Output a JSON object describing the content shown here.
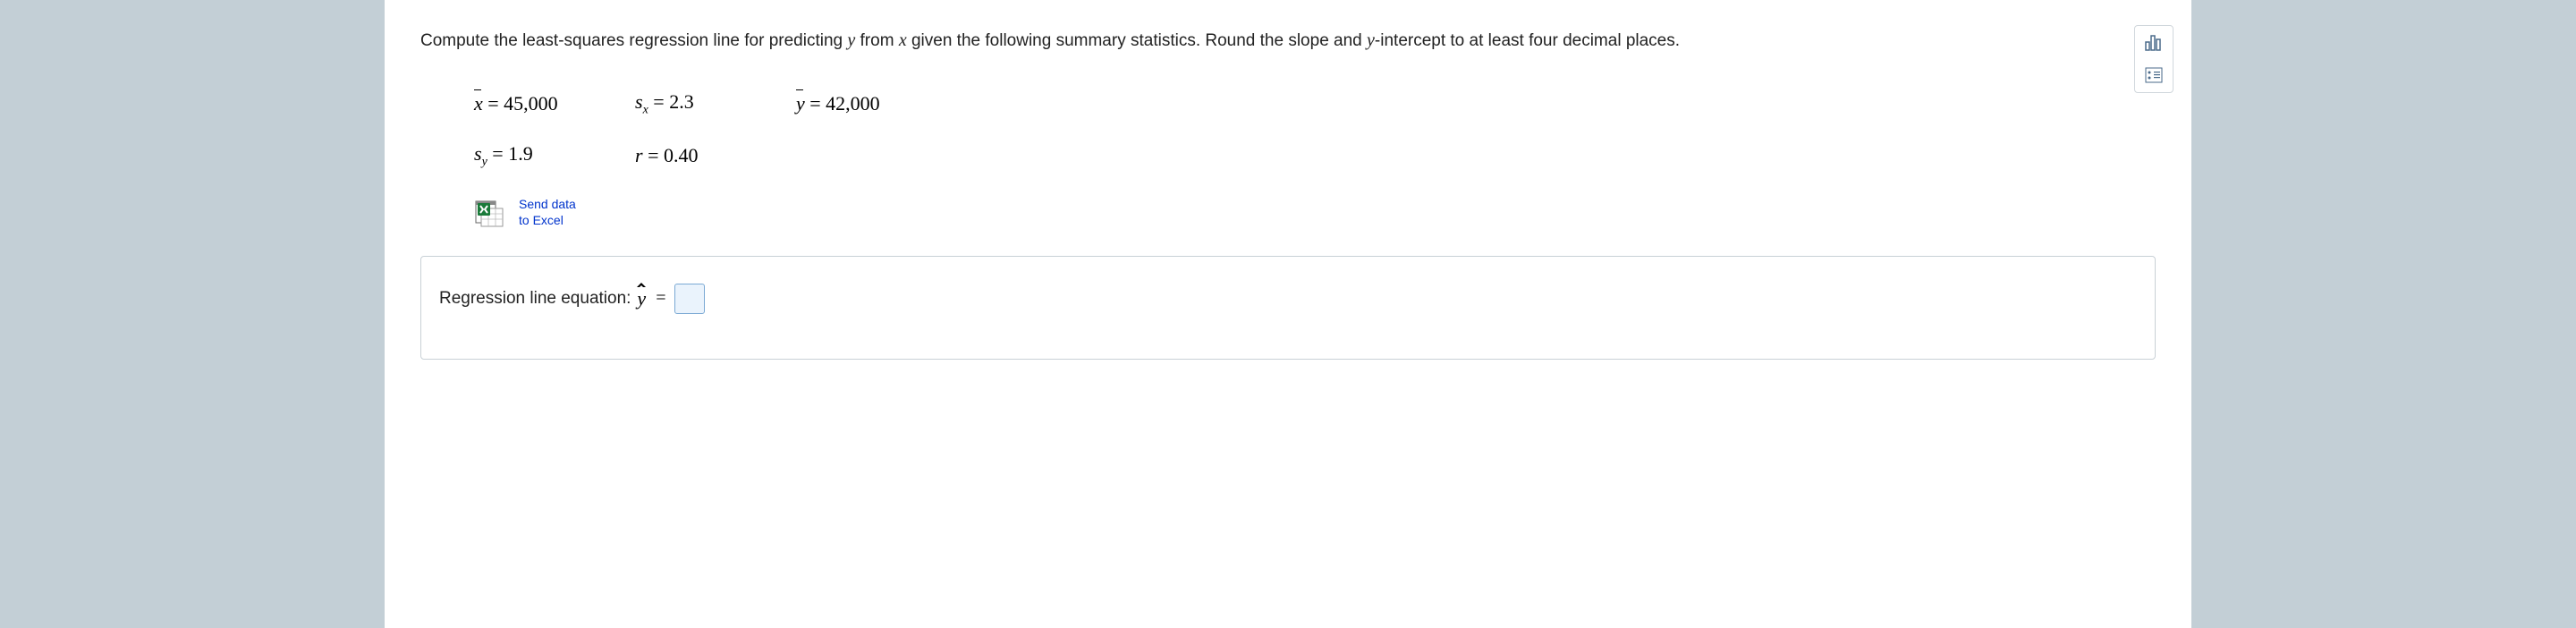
{
  "question": {
    "prefix": "Compute the least-squares regression line for predicting ",
    "var_y": "y",
    "mid1": " from ",
    "var_x": "x",
    "mid2": " given the following summary statistics. Round the slope and ",
    "var_y2": "y",
    "suffix": "-intercept to at least four decimal places."
  },
  "stats": {
    "xbar_label": "x",
    "xbar_value": "= 45,000",
    "sx_label_s": "s",
    "sx_label_sub": "x",
    "sx_value": "= 2.3",
    "ybar_label": "y",
    "ybar_value": "= 42,000",
    "sy_label_s": "s",
    "sy_label_sub": "y",
    "sy_value": "= 1.9",
    "r_label": "r",
    "r_value": "= 0.40"
  },
  "excel_link": {
    "line1": "Send data",
    "line2": "to Excel"
  },
  "answer": {
    "label": "Regression line equation: ",
    "yhat": "y",
    "eq": "=",
    "value": ""
  },
  "tools": {
    "chart": "chart-icon",
    "scatter": "scatter-icon"
  }
}
